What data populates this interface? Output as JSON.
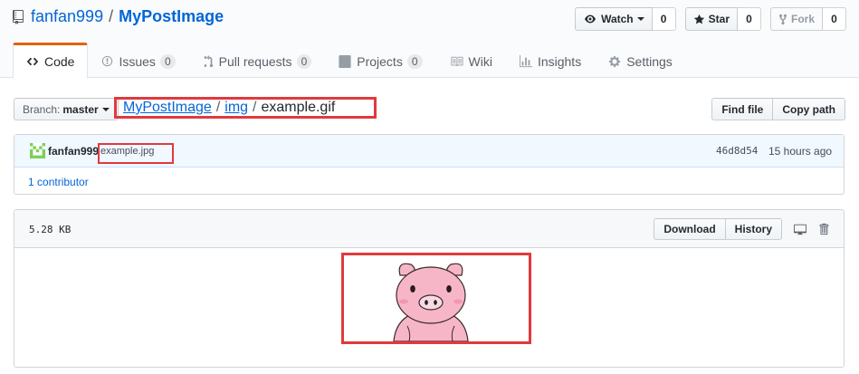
{
  "repo": {
    "owner": "fanfan999",
    "separator": "/",
    "name": "MyPostImage"
  },
  "actions": {
    "watch_label": "Watch",
    "watch_count": "0",
    "star_label": "Star",
    "star_count": "0",
    "fork_label": "Fork",
    "fork_count": "0"
  },
  "tabs": [
    {
      "label": "Code",
      "icon": "code-icon",
      "selected": true
    },
    {
      "label": "Issues",
      "icon": "issue-icon",
      "count": "0"
    },
    {
      "label": "Pull requests",
      "icon": "pull-request-icon",
      "count": "0"
    },
    {
      "label": "Projects",
      "icon": "project-icon",
      "count": "0"
    },
    {
      "label": "Wiki",
      "icon": "book-icon"
    },
    {
      "label": "Insights",
      "icon": "graph-icon"
    },
    {
      "label": "Settings",
      "icon": "gear-icon"
    }
  ],
  "branch": {
    "label": "Branch:",
    "value": "master"
  },
  "breadcrumb": {
    "root": "MyPostImage",
    "folder": "img",
    "file": "example.gif",
    "separator": "/"
  },
  "file_nav": {
    "find_file": "Find file",
    "copy_path": "Copy path"
  },
  "commit": {
    "author": "fanfan999",
    "message": "example.jpg",
    "sha": "46d8d54",
    "time": "15 hours ago",
    "contributors_count": "1",
    "contributors_label": "contributor"
  },
  "file": {
    "size": "5.28 KB",
    "download": "Download",
    "history": "History"
  },
  "colors": {
    "link": "#0366d6",
    "tab_accent": "#e36209",
    "annotation_red": "#e03a3e",
    "pig_pink": "#f7b6c8"
  }
}
